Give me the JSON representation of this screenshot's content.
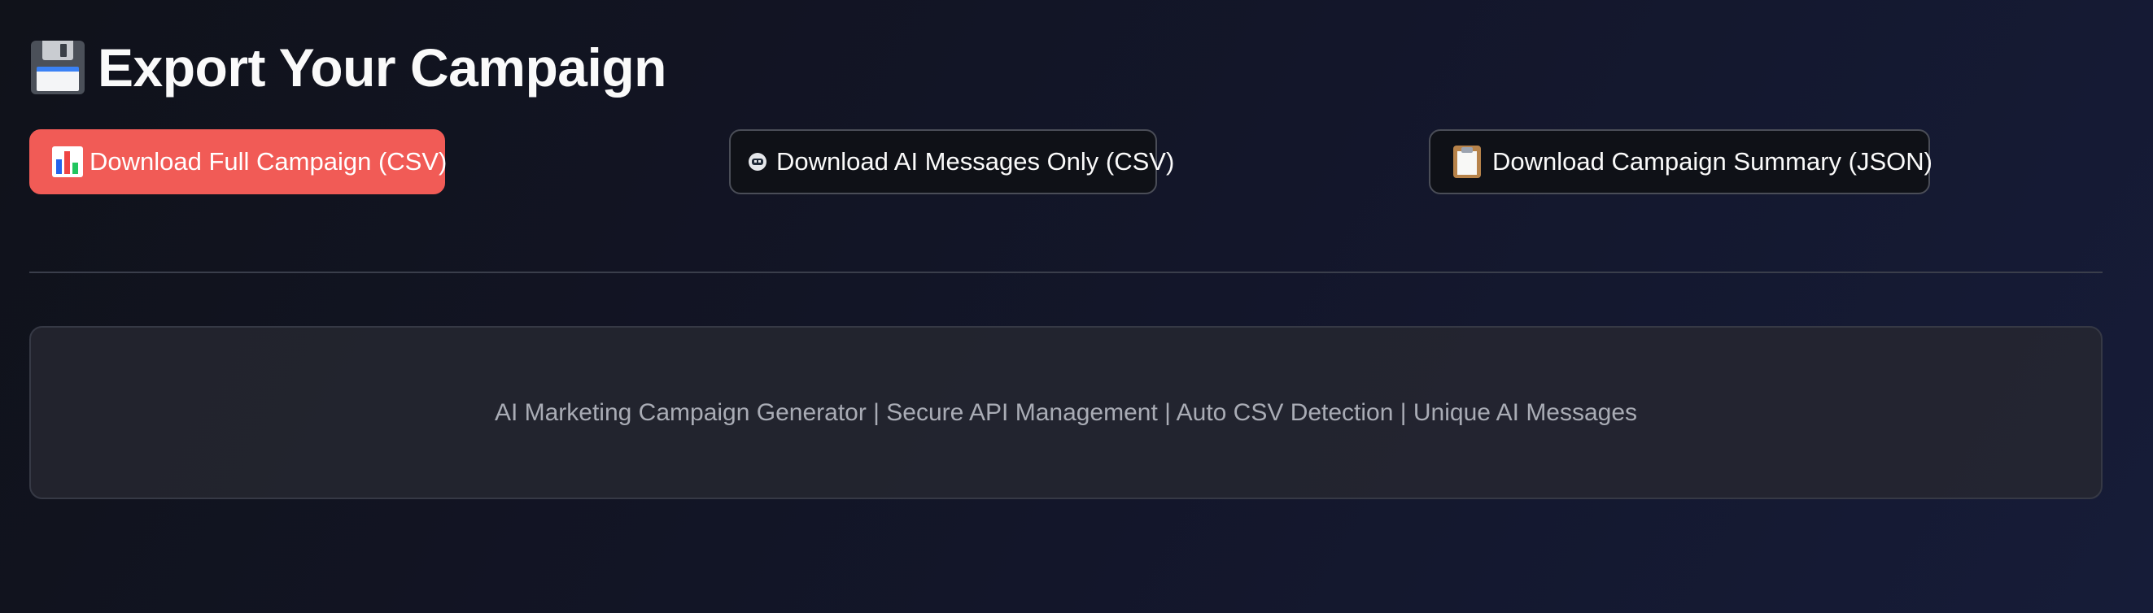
{
  "export": {
    "title": "Export Your Campaign",
    "title_icon": "floppy-disk-icon",
    "buttons": [
      {
        "label": "Download Full Campaign (CSV)",
        "icon": "bar-chart-icon",
        "style": "primary"
      },
      {
        "label": "Download AI Messages Only (CSV)",
        "icon": "robot-icon",
        "style": "secondary"
      },
      {
        "label": "Download Campaign Summary (JSON)",
        "icon": "clipboard-icon",
        "style": "secondary"
      }
    ]
  },
  "footer": {
    "text": "AI Marketing Campaign Generator | Secure API Management | Auto CSV Detection | Unique AI Messages"
  },
  "colors": {
    "primary_button": "#f15b56",
    "background": "#12141f",
    "secondary_button_border": "#4a4d57",
    "footer_text": "#a9acb5"
  }
}
